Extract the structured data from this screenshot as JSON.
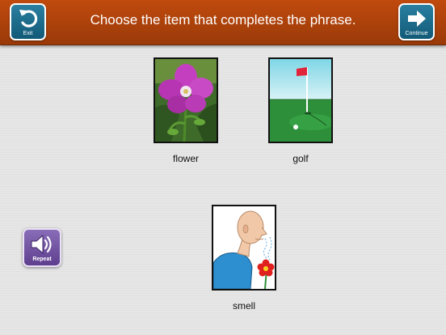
{
  "header": {
    "title": "Choose the item that completes the phrase.",
    "exit_label": "Exit",
    "continue_label": "Continue",
    "exit_icon": "undo-arrow-icon",
    "continue_icon": "right-arrow-icon",
    "bar_color": "#b0420c"
  },
  "choices": [
    {
      "label": "flower",
      "icon": "flower-picture"
    },
    {
      "label": "golf",
      "icon": "golf-flag-picture"
    },
    {
      "label": "smell",
      "icon": "person-smelling-picture"
    }
  ],
  "repeat": {
    "label": "Repeat",
    "icon": "speaker-icon",
    "color": "#6e4f9e"
  }
}
